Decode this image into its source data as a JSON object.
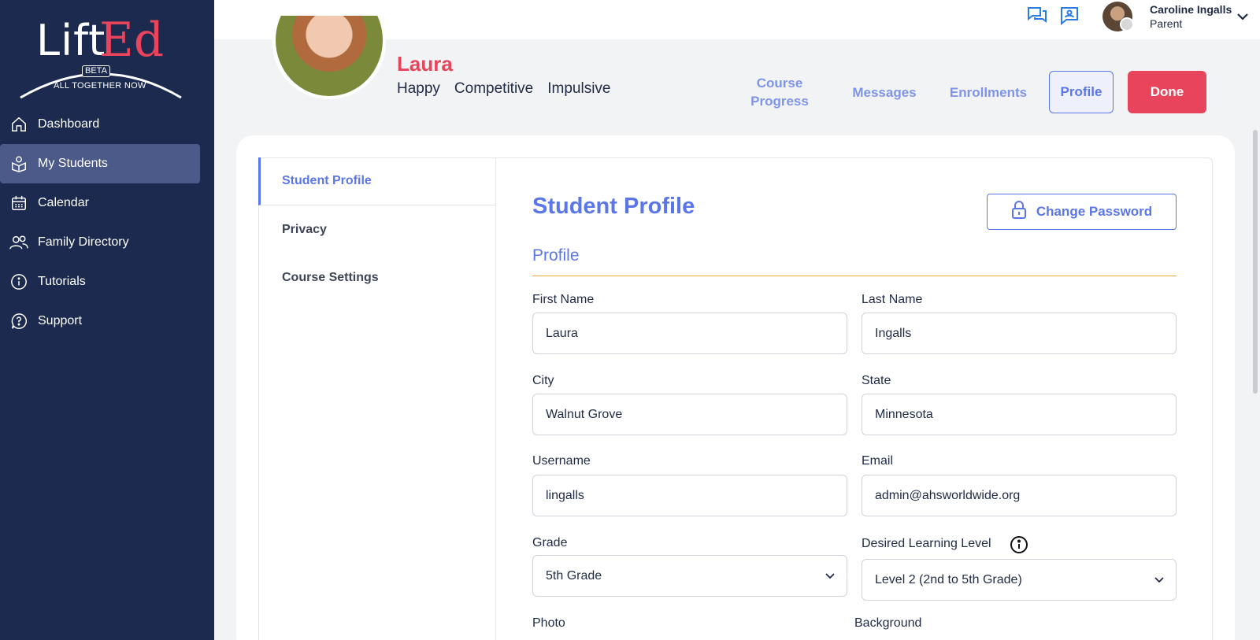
{
  "brand": {
    "logo_lift": "Lift",
    "logo_ed": "Ed",
    "beta": "BETA",
    "tagline": "ALL TOGETHER NOW"
  },
  "sidebar": {
    "items": [
      {
        "label": "Dashboard",
        "icon": "home-icon",
        "active": false
      },
      {
        "label": "My Students",
        "icon": "student-icon",
        "active": true
      },
      {
        "label": "Calendar",
        "icon": "calendar-icon",
        "active": false
      },
      {
        "label": "Family Directory",
        "icon": "people-icon",
        "active": false
      },
      {
        "label": "Tutorials",
        "icon": "info-icon",
        "active": false
      },
      {
        "label": "Support",
        "icon": "help-icon",
        "active": false
      }
    ]
  },
  "header": {
    "user_name": "Caroline Ingalls",
    "user_role": "Parent"
  },
  "student": {
    "name": "Laura",
    "traits": [
      "Happy",
      "Competitive",
      "Impulsive"
    ]
  },
  "student_nav": {
    "course_progress": "Course Progress",
    "messages": "Messages",
    "enrollments": "Enrollments",
    "profile": "Profile",
    "done": "Done"
  },
  "subnav": {
    "items": [
      "Student Profile",
      "Privacy",
      "Course Settings"
    ]
  },
  "content": {
    "title": "Student Profile",
    "change_password": "Change Password",
    "section": "Profile"
  },
  "form": {
    "first_name_label": "First Name",
    "first_name": "Laura",
    "last_name_label": "Last Name",
    "last_name": "Ingalls",
    "city_label": "City",
    "city": "Walnut Grove",
    "state_label": "State",
    "state": "Minnesota",
    "username_label": "Username",
    "username": "lingalls",
    "email_label": "Email",
    "email": "admin@ahsworldwide.org",
    "grade_label": "Grade",
    "grade": "5th Grade",
    "level_label": "Desired Learning Level",
    "level": "Level 2 (2nd to 5th Grade)",
    "photo_label": "Photo",
    "background_label": "Background"
  },
  "colors": {
    "sidebar_bg": "#1b2a4e",
    "accent_blue": "#5b76e8",
    "accent_red": "#e8455c",
    "divider_gold": "#e9a93a"
  }
}
